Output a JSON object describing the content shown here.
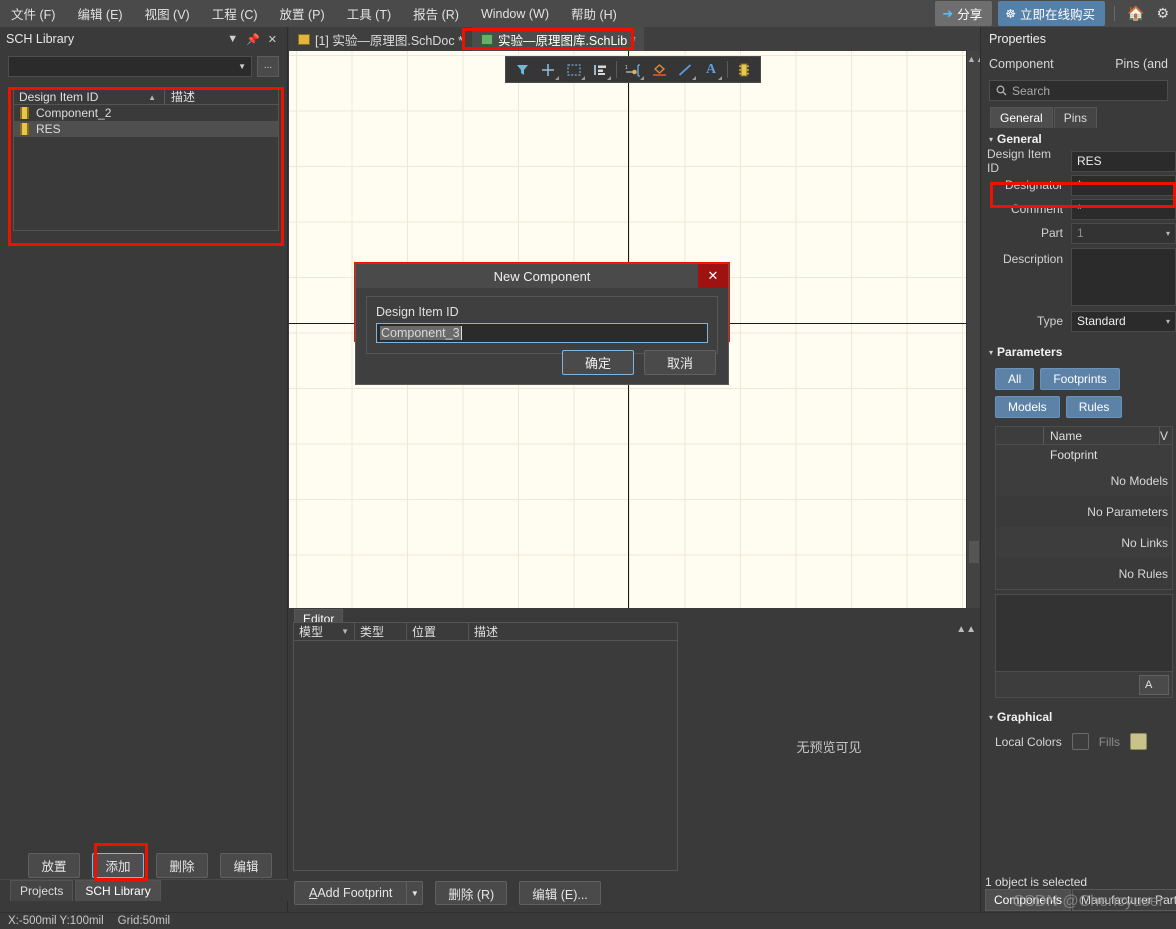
{
  "menubar": {
    "items": [
      {
        "label": "文件 (F)"
      },
      {
        "label": "编辑 (E)"
      },
      {
        "label": "视图 (V)"
      },
      {
        "label": "工程 (C)"
      },
      {
        "label": "放置 (P)"
      },
      {
        "label": "工具 (T)"
      },
      {
        "label": "报告 (R)"
      },
      {
        "label": "Window (W)"
      },
      {
        "label": "帮助 (H)"
      }
    ],
    "share_label": "分享",
    "buy_label": "立即在线购买"
  },
  "left_panel": {
    "title": "SCH Library",
    "library_combo_value": "",
    "dots_label": "...",
    "columns": {
      "id": "Design Item ID",
      "desc": "描述"
    },
    "components": [
      {
        "name": "Component_2",
        "selected": false
      },
      {
        "name": "RES",
        "selected": true
      }
    ],
    "buttons": [
      {
        "label": "放置",
        "active": false
      },
      {
        "label": "添加",
        "active": true
      },
      {
        "label": "删除",
        "active": false
      },
      {
        "label": "编辑",
        "active": false
      }
    ],
    "tabs": [
      {
        "label": "Projects",
        "active": false
      },
      {
        "label": "SCH Library",
        "active": true
      }
    ]
  },
  "doc_tabs": [
    {
      "label": "[1] 实验—原理图.SchDoc *",
      "active": false
    },
    {
      "label": "实验—原理图库.SchLib *",
      "active": true
    }
  ],
  "canvas": {
    "editor_tab": "Editor",
    "model_table_columns": [
      "模型",
      "类型",
      "位置",
      "描述"
    ],
    "preview_message": "无预览可见",
    "footer": {
      "add_footprint": "Add Footprint",
      "delete": "删除 (R)",
      "edit": "编辑 (E)..."
    }
  },
  "dialog": {
    "title": "New Component",
    "field_label": "Design Item ID",
    "field_value": "Component_3",
    "ok_label": "确定",
    "cancel_label": "取消",
    "close_glyph": "✕"
  },
  "properties": {
    "title": "Properties",
    "object_type": "Component",
    "pins_label": "Pins (and",
    "search_placeholder": "Search",
    "tabs": [
      {
        "label": "General",
        "active": true
      },
      {
        "label": "Pins",
        "active": false
      }
    ],
    "general_section": "General",
    "fields": [
      {
        "label": "Design Item ID",
        "value": "RES",
        "type": "text"
      },
      {
        "label": "Designator",
        "value": "*",
        "type": "text"
      },
      {
        "label": "Comment",
        "value": "*",
        "type": "text"
      },
      {
        "label": "Part",
        "value": "1",
        "type": "combo"
      },
      {
        "label": "Description",
        "value": "",
        "type": "textarea"
      },
      {
        "label": "Type",
        "value": "Standard",
        "type": "combo"
      }
    ],
    "parameters_section": "Parameters",
    "param_buttons": [
      "All",
      "Footprints",
      "Models",
      "Rules"
    ],
    "param_table": {
      "columns": [
        "",
        "Name",
        "V"
      ],
      "rows": [
        {
          "name": "Footprint"
        }
      ],
      "empty_messages": [
        "No Models",
        "No Parameters",
        "No Links",
        "No Rules"
      ]
    },
    "add_button": "A",
    "graphical_section": "Graphical",
    "local_colors_label": "Local Colors",
    "fills_label": "Fills",
    "status": "1 object is selected",
    "bottom_tabs": [
      {
        "label": "Components",
        "active": true
      },
      {
        "label": "Manufacturer Part Se",
        "active": false
      }
    ]
  },
  "statusbar": {
    "coords": "X:-500mil Y:100mil",
    "grid": "Grid:50mil"
  },
  "watermark": "CSDN @Chencyuser"
}
